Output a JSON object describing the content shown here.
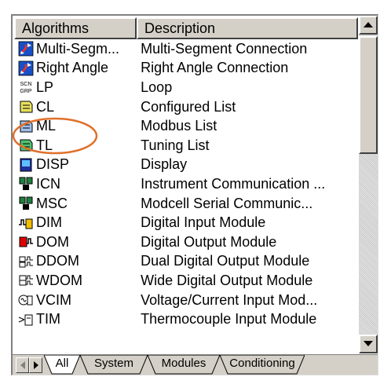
{
  "columns": {
    "algorithms": "Algorithms",
    "description": "Description"
  },
  "rows": [
    {
      "name": "Multi-Segm...",
      "description": "Multi-Segment Connection",
      "icon": "multi-segment-icon"
    },
    {
      "name": "Right Angle",
      "description": "Right Angle Connection",
      "icon": "right-angle-icon"
    },
    {
      "name": "LP",
      "description": "Loop",
      "icon": "loop-icon",
      "icon_text": "SCN\nGRP"
    },
    {
      "name": "CL",
      "description": "Configured List",
      "icon": "configured-list-icon"
    },
    {
      "name": "ML",
      "description": "Modbus List",
      "icon": "modbus-list-icon"
    },
    {
      "name": "TL",
      "description": "Tuning List",
      "icon": "tuning-list-icon"
    },
    {
      "name": "DISP",
      "description": "Display",
      "icon": "display-icon"
    },
    {
      "name": "ICN",
      "description": "Instrument Communication ...",
      "icon": "icn-icon"
    },
    {
      "name": "MSC",
      "description": "Modcell Serial Communic...",
      "icon": "msc-icon"
    },
    {
      "name": "DIM",
      "description": "Digital Input Module",
      "icon": "digital-input-icon"
    },
    {
      "name": "DOM",
      "description": "Digital Output Module",
      "icon": "digital-output-icon"
    },
    {
      "name": "DDOM",
      "description": "Dual Digital Output Module",
      "icon": "dual-digital-output-icon"
    },
    {
      "name": "WDOM",
      "description": "Wide Digital Output Module",
      "icon": "wide-digital-output-icon"
    },
    {
      "name": "VCIM",
      "description": "Voltage/Current Input Mod...",
      "icon": "voltage-current-input-icon"
    },
    {
      "name": "TIM",
      "description": "Thermocouple Input Module",
      "icon": "thermocouple-input-icon"
    }
  ],
  "tabs": [
    "All",
    "System",
    "Modules",
    "Conditioning"
  ],
  "active_tab": "All",
  "annotation_color": "#e0702a"
}
